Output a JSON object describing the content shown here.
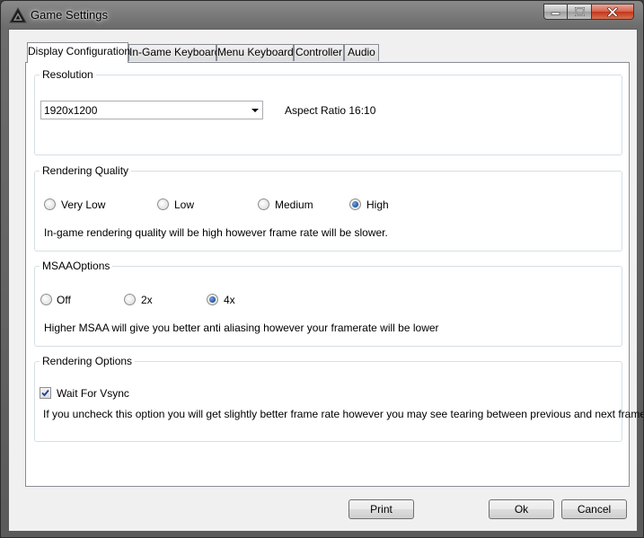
{
  "window": {
    "title": "Game Settings",
    "controls": {
      "minimize_icon": "minimize-icon",
      "maximize_icon": "maximize-icon",
      "close_icon": "close-icon"
    }
  },
  "tabs": [
    {
      "label": "Display Configuration",
      "active": true
    },
    {
      "label": "In-Game Keyboard",
      "active": false
    },
    {
      "label": "Menu Keyboard",
      "active": false
    },
    {
      "label": "Controller",
      "active": false
    },
    {
      "label": "Audio",
      "active": false
    }
  ],
  "resolution": {
    "legend": "Resolution",
    "selected": "1920x1200",
    "aspect_ratio": "Aspect Ratio 16:10"
  },
  "rendering_quality": {
    "legend": "Rendering Quality",
    "options": [
      "Very Low",
      "Low",
      "Medium",
      "High"
    ],
    "selected": "High",
    "description": "In-game rendering quality will be high however frame rate will be slower."
  },
  "msaa": {
    "legend": "MSAAOptions",
    "options": [
      "Off",
      "2x",
      "4x"
    ],
    "selected": "4x",
    "description": "Higher MSAA will give you better anti aliasing however your framerate will be lower"
  },
  "rendering_options": {
    "legend": "Rendering Options",
    "vsync_label": "Wait For Vsync",
    "vsync_checked": true,
    "description": "If you uncheck this option you will get slightly better frame rate however you may see tearing between previous and next frames."
  },
  "buttons": {
    "print": "Print",
    "ok": "Ok",
    "cancel": "Cancel"
  },
  "colors": {
    "radio_selected": "#2a5ea8",
    "check_mark": "#1c3f94",
    "close_button": "#c3361c"
  }
}
